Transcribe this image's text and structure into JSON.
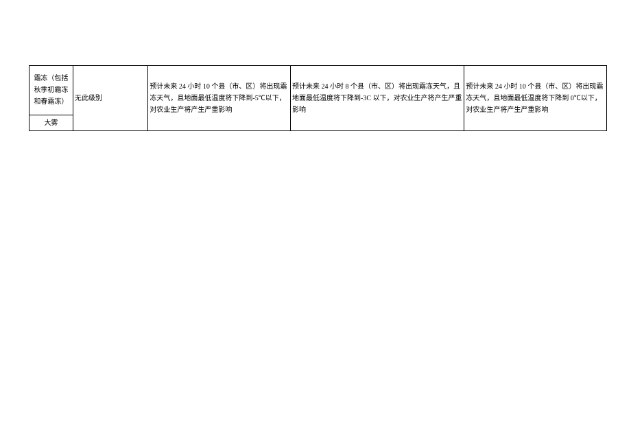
{
  "table": {
    "rows": [
      {
        "category": "霜冻（包括秋季初霜冻和春霜冻）",
        "level": "无此级别",
        "desc1": "预计未来 24 小时 10 个县（市、区）将出现霜冻天气，且地面最低温度将下降到-5℃以下，对农业生产将产生严重影响",
        "desc2": "预计未来 24 小时 8 个县（市、区）将出现霜冻天气，且地面最低温度将下降到-3C 以下，对农业生产将产生严重影响",
        "desc3": "预计未来 24 小时 10 个县（市、区）将出现霜冻天气，且地面最低温度将下降到 0℃以下，对农业生产将产生严重影响"
      },
      {
        "category": "大雾"
      }
    ]
  }
}
